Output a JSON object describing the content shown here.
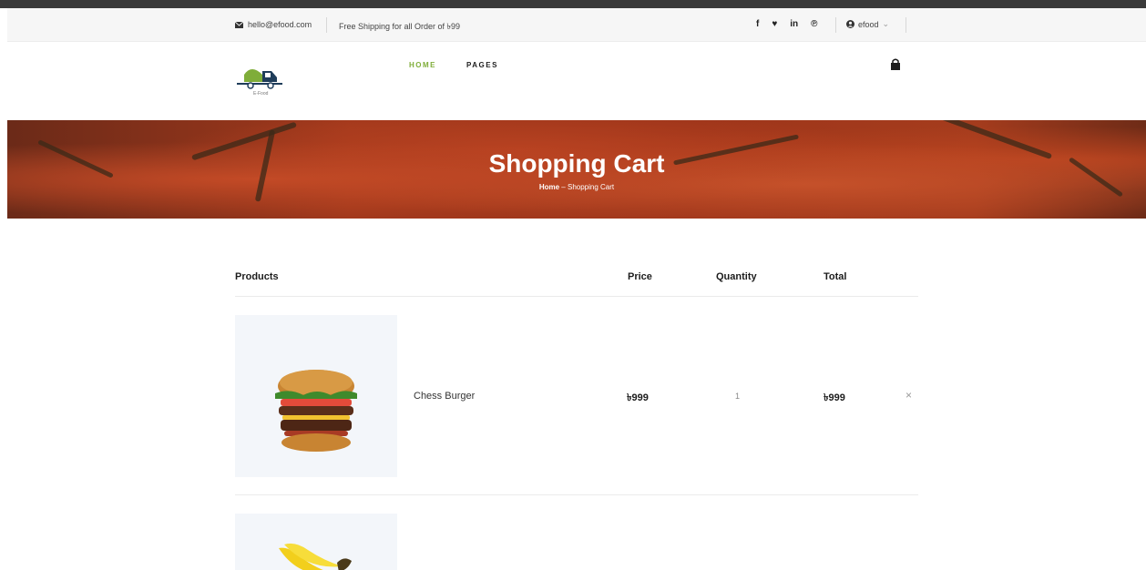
{
  "topbar": {
    "email": "hello@efood.com",
    "shipping": "Free Shipping for all Order of ৳99",
    "social": [
      "f",
      "♥",
      "in",
      "℗"
    ],
    "account": "efood",
    "account_caret": "⌄",
    "icons": [
      "envelope-icon",
      "user-circle-icon"
    ]
  },
  "header": {
    "logo_caption": "E-Food",
    "nav": [
      "HOME",
      "PAGES"
    ],
    "cart_icon": "shopping-bag-icon",
    "accent_color": "#7fad39"
  },
  "hero": {
    "title": "Shopping Cart",
    "breadcrumb_home": "Home",
    "breadcrumb_sep": " – ",
    "breadcrumb_current": "Shopping Cart"
  },
  "cart": {
    "columns": [
      "Products",
      "Price",
      "Quantity",
      "Total"
    ],
    "items": [
      {
        "name": "Chess Burger",
        "price": "৳999",
        "quantity": "1",
        "total": "৳999",
        "remove": "×",
        "image": "burger-image"
      },
      {
        "name": "",
        "price": "",
        "quantity": "",
        "total": "",
        "remove": "",
        "image": "banana-image"
      }
    ]
  }
}
